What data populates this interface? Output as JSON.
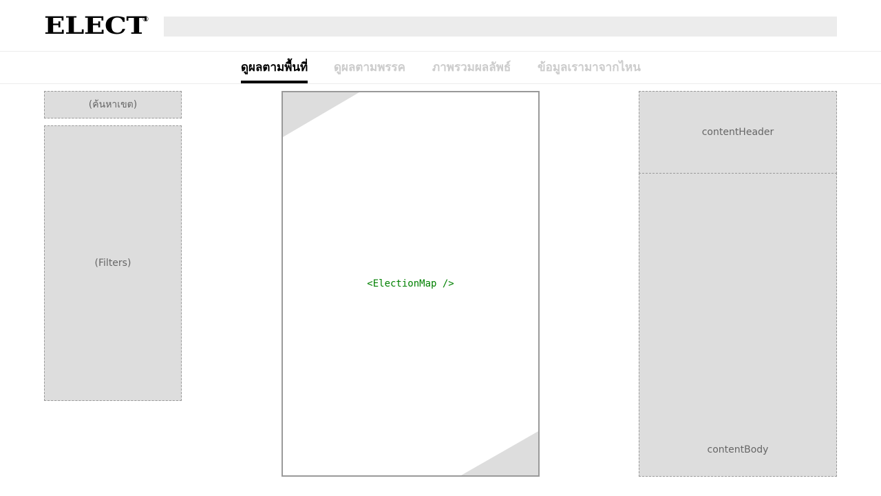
{
  "header": {
    "logo_text": "ELECT",
    "logo_mark": "®",
    "search_placeholder": ""
  },
  "nav": {
    "tabs": [
      {
        "label": "ดูผลตามพื้นที่",
        "active": true
      },
      {
        "label": "ดูผลตามพรรค",
        "active": false
      },
      {
        "label": "ภาพรวมผลลัพธ์",
        "active": false
      },
      {
        "label": "ข้อมูลเรามาจากไหน",
        "active": false
      }
    ]
  },
  "left_panel": {
    "search_label": "(ค้นหาเขต)",
    "filters_label": "(Filters)"
  },
  "map": {
    "label": "<ElectionMap />"
  },
  "right_panel": {
    "header_label": "contentHeader",
    "body_label": "contentBody"
  },
  "colors": {
    "accent": "#000000",
    "inactive_tab": "#cccccc",
    "placeholder_fill": "#dddddd",
    "map_label": "#008000"
  }
}
